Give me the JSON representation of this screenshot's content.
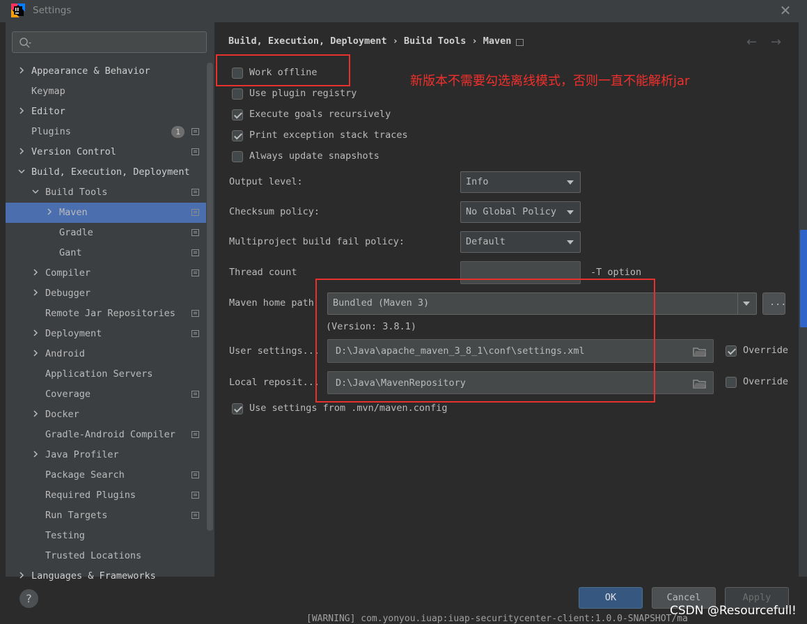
{
  "window": {
    "title": "Settings"
  },
  "search": {
    "placeholder": ""
  },
  "sidebar": {
    "items": [
      {
        "label": "Appearance & Behavior",
        "indent": 0,
        "expandable": true,
        "expanded": false
      },
      {
        "label": "Keymap",
        "indent": 0,
        "expandable": false
      },
      {
        "label": "Editor",
        "indent": 0,
        "expandable": true,
        "expanded": false
      },
      {
        "label": "Plugins",
        "indent": 0,
        "expandable": false,
        "badge": "1",
        "project_icon": true
      },
      {
        "label": "Version Control",
        "indent": 0,
        "expandable": true,
        "expanded": false,
        "project_icon": true
      },
      {
        "label": "Build, Execution, Deployment",
        "indent": 0,
        "expandable": true,
        "expanded": true
      },
      {
        "label": "Build Tools",
        "indent": 1,
        "expandable": true,
        "expanded": true,
        "project_icon": true
      },
      {
        "label": "Maven",
        "indent": 2,
        "expandable": true,
        "expanded": false,
        "project_icon": true,
        "selected": true
      },
      {
        "label": "Gradle",
        "indent": 2,
        "expandable": false,
        "project_icon": true
      },
      {
        "label": "Gant",
        "indent": 2,
        "expandable": false,
        "project_icon": true
      },
      {
        "label": "Compiler",
        "indent": 1,
        "expandable": true,
        "expanded": false,
        "project_icon": true
      },
      {
        "label": "Debugger",
        "indent": 1,
        "expandable": true,
        "expanded": false
      },
      {
        "label": "Remote Jar Repositories",
        "indent": 1,
        "expandable": false,
        "project_icon": true
      },
      {
        "label": "Deployment",
        "indent": 1,
        "expandable": true,
        "expanded": false,
        "project_icon": true
      },
      {
        "label": "Android",
        "indent": 1,
        "expandable": true,
        "expanded": false
      },
      {
        "label": "Application Servers",
        "indent": 1,
        "expandable": false
      },
      {
        "label": "Coverage",
        "indent": 1,
        "expandable": false,
        "project_icon": true
      },
      {
        "label": "Docker",
        "indent": 1,
        "expandable": true,
        "expanded": false
      },
      {
        "label": "Gradle-Android Compiler",
        "indent": 1,
        "expandable": false,
        "project_icon": true
      },
      {
        "label": "Java Profiler",
        "indent": 1,
        "expandable": true,
        "expanded": false
      },
      {
        "label": "Package Search",
        "indent": 1,
        "expandable": false,
        "project_icon": true
      },
      {
        "label": "Required Plugins",
        "indent": 1,
        "expandable": false,
        "project_icon": true
      },
      {
        "label": "Run Targets",
        "indent": 1,
        "expandable": false,
        "project_icon": true
      },
      {
        "label": "Testing",
        "indent": 1,
        "expandable": false
      },
      {
        "label": "Trusted Locations",
        "indent": 1,
        "expandable": false
      },
      {
        "label": "Languages & Frameworks",
        "indent": 0,
        "expandable": true,
        "expanded": false
      }
    ]
  },
  "breadcrumb": "Build, Execution, Deployment › Build Tools › Maven",
  "nav": {
    "back_icon": "arrow-left-icon",
    "forward_icon": "arrow-right-icon"
  },
  "checkboxes": [
    {
      "label": "Work offline",
      "checked": false
    },
    {
      "label": "Use plugin registry",
      "checked": false
    },
    {
      "label": "Execute goals recursively",
      "checked": true
    },
    {
      "label": "Print exception stack traces",
      "checked": true
    },
    {
      "label": "Always update snapshots",
      "checked": false
    }
  ],
  "form": {
    "output_level": {
      "label": "Output level:",
      "value": "Info"
    },
    "checksum_policy": {
      "label": "Checksum policy:",
      "value": "No Global Policy"
    },
    "fail_policy": {
      "label": "Multiproject build fail policy:",
      "value": "Default"
    },
    "thread_count": {
      "label": "Thread count",
      "value": "",
      "suffix": "-T option"
    },
    "maven_home": {
      "label": "Maven home path:",
      "value": "Bundled (Maven 3)",
      "browse": "...",
      "version": "(Version: 3.8.1)"
    },
    "user_settings": {
      "label": "User settings...",
      "value": "D:\\Java\\apache_maven_3_8_1\\conf\\settings.xml",
      "override_label": "Override",
      "override_checked": true
    },
    "local_repo": {
      "label": "Local reposit...",
      "value": "D:\\Java\\MavenRepository",
      "override_label": "Override",
      "override_checked": false
    },
    "mvn_config": {
      "label": "Use settings from .mvn/maven.config",
      "checked": true
    }
  },
  "annotation": "新版本不需要勾选离线模式，否则一直不能解析jar",
  "buttons": {
    "ok": "OK",
    "cancel": "Cancel",
    "apply": "Apply",
    "help": "?"
  },
  "watermark": "CSDN @Resourcefull!",
  "background_log": "[WARNING] com.yonyou.iuap:iuap-securitycenter-client:1.0.0-SNAPSHOT/ma",
  "colors": {
    "accent_selected": "#4b6eaf",
    "annotation_red": "#e8312c",
    "ok_button": "#365880"
  }
}
